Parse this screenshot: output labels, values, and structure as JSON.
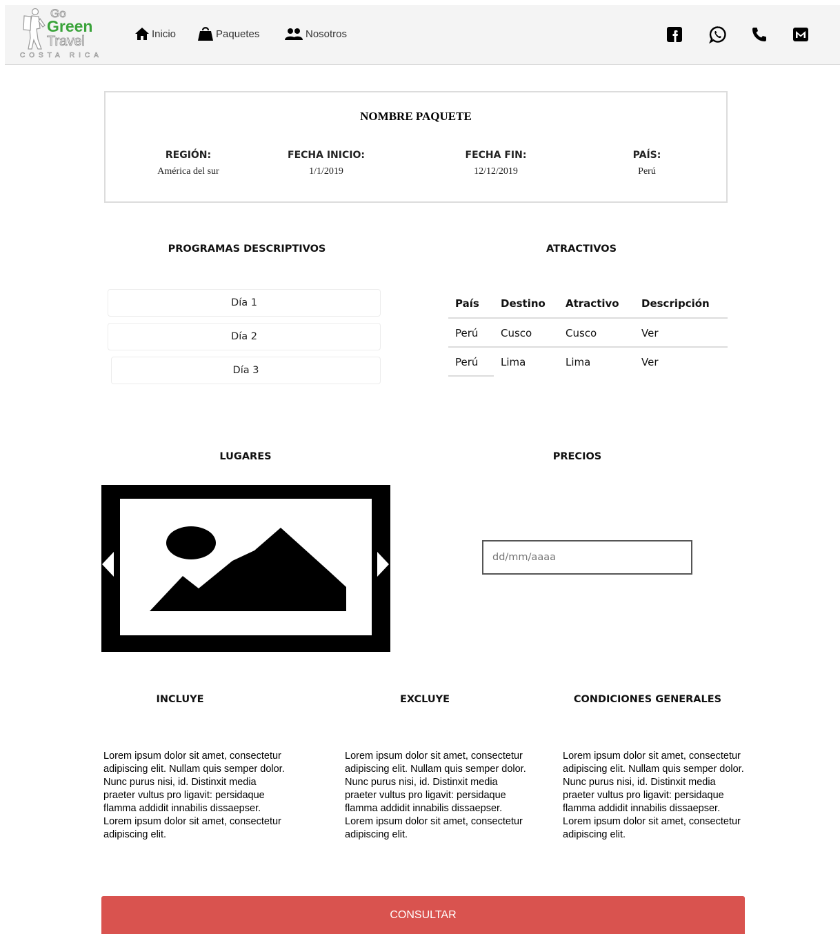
{
  "brand": {
    "line1": "Go",
    "line2": "Green",
    "line3": "Travel",
    "line4": "COSTA RICA"
  },
  "nav": [
    {
      "label": "Inicio",
      "icon": "home-icon"
    },
    {
      "label": "Paquetes",
      "icon": "bag-icon"
    },
    {
      "label": "Nosotros",
      "icon": "people-icon"
    }
  ],
  "social": [
    "facebook-icon",
    "whatsapp-icon",
    "phone-icon",
    "mail-icon"
  ],
  "package": {
    "title": "NOMBRE PAQUETE",
    "fields": [
      {
        "label": "REGIÓN:",
        "value": "América del sur"
      },
      {
        "label": "FECHA INICIO:",
        "value": "1/1/2019"
      },
      {
        "label": "FECHA FIN:",
        "value": "12/12/2019"
      },
      {
        "label": "PAÍS:",
        "value": "Perú"
      }
    ]
  },
  "programs": {
    "title": "PROGRAMAS DESCRIPTIVOS",
    "days": [
      "Día 1",
      "Día 2",
      "Día 3"
    ]
  },
  "attractions": {
    "title": "ATRACTIVOS",
    "columns": [
      "País",
      "Destino",
      "Atractivo",
      "Descripción"
    ],
    "rows": [
      [
        "Perú",
        "Cusco",
        "Cusco",
        "Ver"
      ],
      [
        "Perú",
        "Lima",
        "Lima",
        "Ver"
      ]
    ]
  },
  "places": {
    "title": "LUGARES"
  },
  "prices": {
    "title": "PRECIOS",
    "date_placeholder": "dd/mm/aaaa"
  },
  "info": [
    {
      "title": "INCLUYE",
      "text": "Lorem ipsum dolor sit amet, consectetur adipiscing elit. Nullam quis semper dolor. Nunc purus nisi, id. Distinxit  media praeter vultus pro ligavit: persidaque flamma addidit innabilis dissaepser. Lorem ipsum dolor sit amet, consectetur adipiscing elit."
    },
    {
      "title": "EXCLUYE",
      "text": "Lorem ipsum dolor sit amet, consectetur adipiscing elit. Nullam quis semper dolor. Nunc purus nisi, id. Distinxit  media praeter vultus pro ligavit: persidaque flamma addidit innabilis dissaepser. Lorem ipsum dolor sit amet, consectetur adipiscing elit."
    },
    {
      "title": "CONDICIONES GENERALES",
      "text": "Lorem ipsum dolor sit amet, consectetur adipiscing elit. Nullam quis semper dolor. Nunc purus nisi, id. Distinxit  media praeter vultus pro ligavit: persidaque flamma addidit innabilis dissaepser. Lorem ipsum dolor sit amet, consectetur adipiscing elit."
    }
  ],
  "cta": {
    "label": "CONSULTAR",
    "color": "#d9534f"
  },
  "colors": {
    "brand_green": "#3aa33a",
    "header_bg": "#f4f4f4"
  }
}
